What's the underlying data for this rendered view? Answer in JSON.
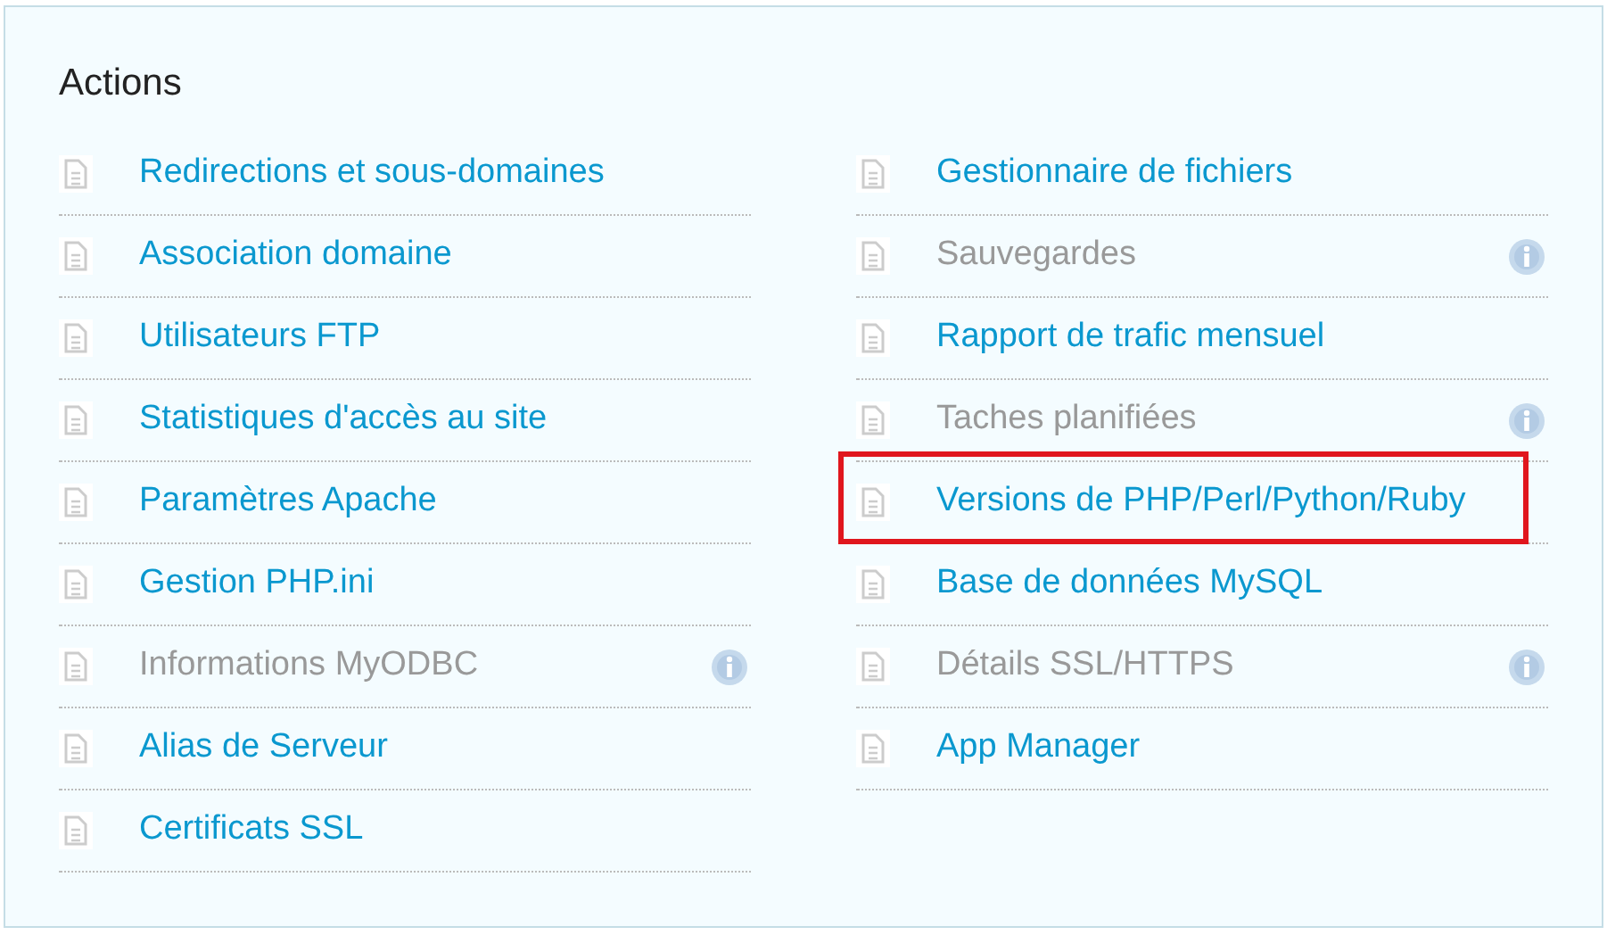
{
  "title": "Actions",
  "columns": [
    {
      "items": [
        {
          "label": "Redirections et sous-domaines",
          "disabled": false,
          "highlighted": false
        },
        {
          "label": "Association domaine",
          "disabled": false,
          "highlighted": false
        },
        {
          "label": "Utilisateurs FTP",
          "disabled": false,
          "highlighted": false
        },
        {
          "label": "Statistiques d'accès au site",
          "disabled": false,
          "highlighted": false
        },
        {
          "label": "Paramètres Apache",
          "disabled": false,
          "highlighted": false
        },
        {
          "label": "Gestion PHP.ini",
          "disabled": false,
          "highlighted": false
        },
        {
          "label": "Informations MyODBC",
          "disabled": true,
          "highlighted": false
        },
        {
          "label": "Alias de Serveur",
          "disabled": false,
          "highlighted": false
        },
        {
          "label": "Certificats SSL",
          "disabled": false,
          "highlighted": false
        }
      ]
    },
    {
      "items": [
        {
          "label": "Gestionnaire de fichiers",
          "disabled": false,
          "highlighted": false
        },
        {
          "label": "Sauvegardes",
          "disabled": true,
          "highlighted": false
        },
        {
          "label": "Rapport de trafic mensuel",
          "disabled": false,
          "highlighted": false
        },
        {
          "label": "Taches planifiées",
          "disabled": true,
          "highlighted": false
        },
        {
          "label": "Versions de PHP/Perl/Python/Ruby",
          "disabled": false,
          "highlighted": true
        },
        {
          "label": "Base de données MySQL",
          "disabled": false,
          "highlighted": false
        },
        {
          "label": "Détails SSL/HTTPS",
          "disabled": true,
          "highlighted": false
        },
        {
          "label": "App Manager",
          "disabled": false,
          "highlighted": false
        }
      ]
    }
  ]
}
